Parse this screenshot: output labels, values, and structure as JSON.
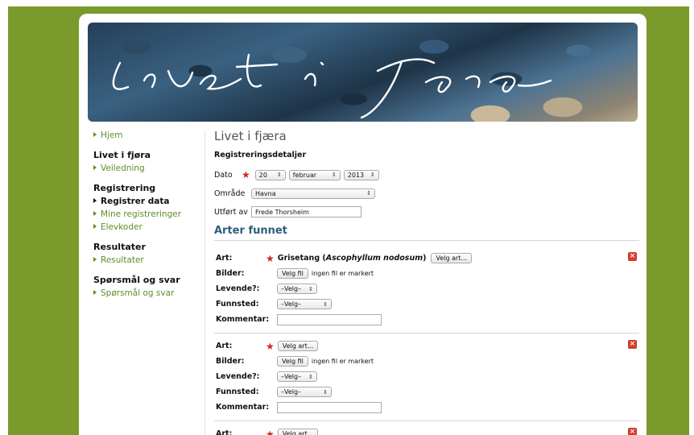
{
  "site_title": "Livet i fjøra",
  "sidebar": {
    "hjem": "Hjem",
    "section1": {
      "head": "Livet i fjøra",
      "items": [
        "Veiledning"
      ]
    },
    "section2": {
      "head": "Registrering",
      "items": [
        "Registrer data",
        "Mine registreringer",
        "Elevkoder"
      ]
    },
    "section3": {
      "head": "Resultater",
      "items": [
        "Resultater"
      ]
    },
    "section4": {
      "head": "Spørsmål og svar",
      "items": [
        "Spørsmål og svar"
      ]
    }
  },
  "main": {
    "title": "Livet i fjæra",
    "details_title": "Registreringsdetaljer",
    "dato_label": "Dato",
    "day": "20",
    "month": "februar",
    "year": "2013",
    "omrade_label": "Område",
    "omrade": "Havna",
    "utfort_label": "Utført av",
    "utfort": "Frede Thorsheim"
  },
  "arter": {
    "title": "Arter funnet",
    "labels": {
      "art": "Art:",
      "bilder": "Bilder:",
      "levende": "Levende?:",
      "funnsted": "Funnsted:",
      "kommentar": "Kommentar:"
    },
    "velg_art": "Velg art...",
    "velg_fil": "Velg fil",
    "no_file": "ingen fil er markert",
    "velg_option": "–Velg–",
    "entry1_species": "Grisetang",
    "entry1_latin": "Ascophyllum nodosum"
  },
  "colors": {
    "background": "#7a9a2b",
    "link": "#5b8e2a",
    "heading": "#2a5f7a",
    "required": "#d0261f"
  }
}
